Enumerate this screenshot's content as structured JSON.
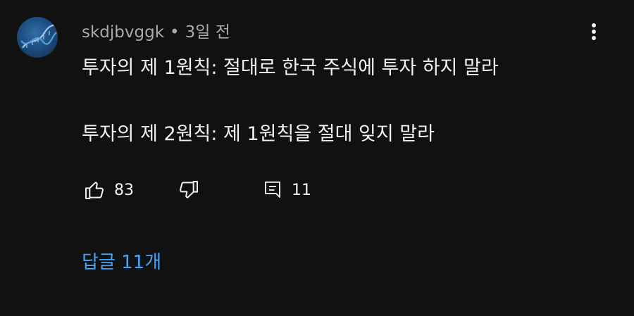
{
  "comment": {
    "username": "skdjbvggk",
    "separator": "•",
    "time": "3일 전",
    "line1": "투자의 제 1원칙: 절대로 한국 주식에 투자 하지 말라",
    "line2": "투자의 제 2원칙: 제 1원칙을 절대 잊지 말라"
  },
  "actions": {
    "like_icon": "thumbs-up-icon",
    "like_count": "83",
    "dislike_icon": "thumbs-down-icon",
    "reply_icon": "comment-icon",
    "reply_count": "11",
    "more_icon": "more-vert-icon"
  },
  "replies": {
    "label": "답글 11개"
  },
  "colors": {
    "background": "#111111",
    "text": "#f1f1f1",
    "meta": "#aaaaaa",
    "link": "#3ea6ff"
  }
}
